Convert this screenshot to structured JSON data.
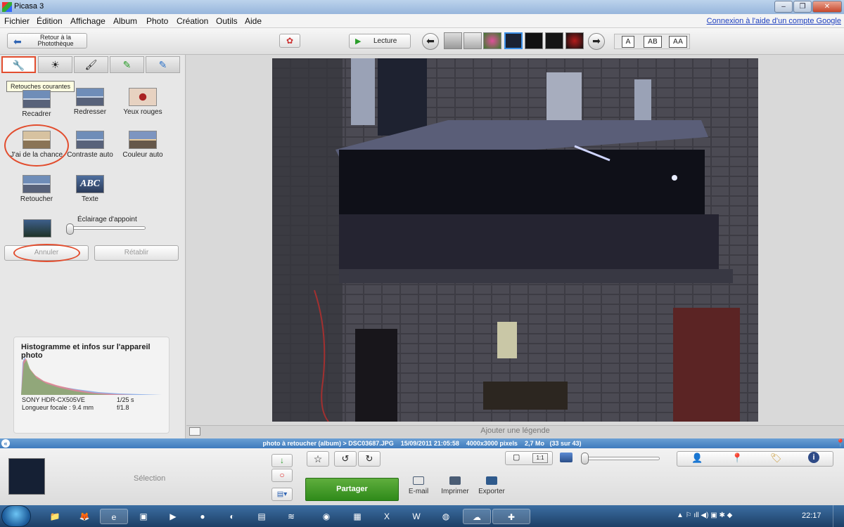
{
  "window": {
    "title": "Picasa 3",
    "controls": [
      "–",
      "❐",
      "✕"
    ]
  },
  "menu": {
    "items": [
      "Fichier",
      "Édition",
      "Affichage",
      "Album",
      "Photo",
      "Création",
      "Outils",
      "Aide"
    ],
    "help_link": "Connexion à l'aide d'un compte Google"
  },
  "toolbar": {
    "back_label": "Retour à la Photothèque",
    "play_label": "Lecture",
    "caption_modes": [
      "A",
      "AB",
      "AA"
    ]
  },
  "edit_tabs": {
    "tooltip": "Retouches courantes"
  },
  "tools": {
    "crop": "Recadrer",
    "straighten": "Redresser",
    "redeye": "Yeux rouges",
    "lucky": "J'ai de la chance",
    "auto_contrast": "Contraste auto",
    "auto_color": "Couleur auto",
    "retouch": "Retoucher",
    "text": "Texte",
    "text_icon": "ABC",
    "fill_light_label": "Éclairage d'appoint",
    "fill_light_value": 0.0,
    "undo": "Annuler",
    "redo": "Rétablir"
  },
  "histogram": {
    "title": "Histogramme et infos sur l'appareil photo",
    "camera": "SONY HDR-CX505VE",
    "focal": "Longueur focale : 9.4 mm",
    "shutter": "1/25 s",
    "aperture": "f/1.8"
  },
  "caption": {
    "placeholder": "Ajouter une légende"
  },
  "info_bar": {
    "path": "photo à retoucher (album) > DSC03687.JPG",
    "date": "15/09/2011 21:05:58",
    "dimensions": "4000x3000 pixels",
    "size": "2,7 Mo",
    "position": "(33 sur 43)"
  },
  "bottom": {
    "selection_label": "Sélection",
    "share_label": "Partager",
    "email_label": "E-mail",
    "print_label": "Imprimer",
    "export_label": "Exporter",
    "zoom_modes": [
      "▢",
      "1:1"
    ]
  },
  "taskbar": {
    "time": "22:17"
  },
  "colors": {
    "accent_blue": "#3f7bbd",
    "share_green": "#3c9a23",
    "annotation": "#e24d2e"
  }
}
